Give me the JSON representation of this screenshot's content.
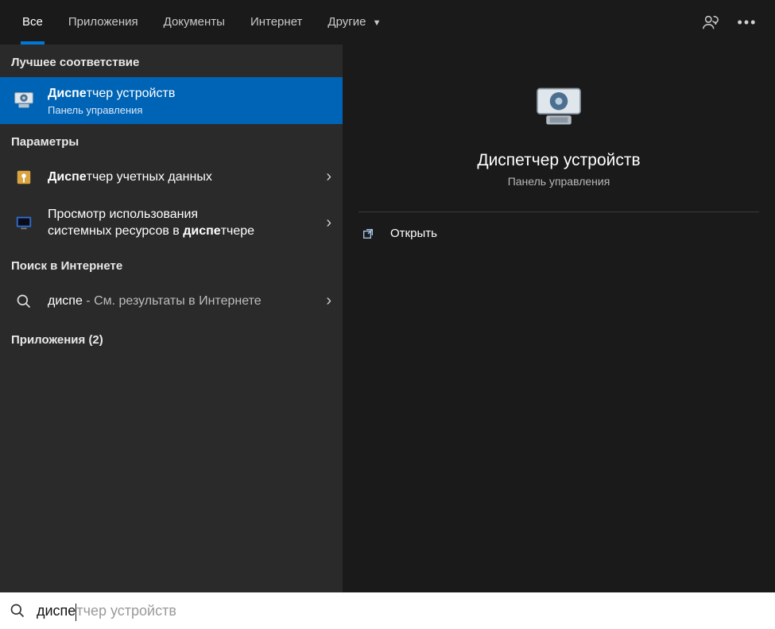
{
  "tabs": {
    "all": "Все",
    "apps": "Приложения",
    "documents": "Документы",
    "internet": "Интернет",
    "more": "Другие"
  },
  "sections": {
    "best_match": "Лучшее соответствие",
    "settings": "Параметры",
    "web_search": "Поиск в Интернете",
    "apps_count_label": "Приложения (2)"
  },
  "best": {
    "title_bold": "Диспе",
    "title_rest": "тчер устройств",
    "subtitle": "Панель управления"
  },
  "settings_items": [
    {
      "bold": "Диспе",
      "rest": "тчер учетных данных"
    },
    {
      "line1": "Просмотр использования",
      "line2_pre": "системных ресурсов в ",
      "line2_bold": "диспе",
      "line2_post": "тчере"
    }
  ],
  "web": {
    "query": "диспе",
    "suffix": " - См. результаты в Интернете"
  },
  "preview": {
    "title": "Диспетчер устройств",
    "subtitle": "Панель управления",
    "open": "Открыть"
  },
  "search": {
    "typed": "диспе",
    "suggest": "тчер устройств"
  }
}
